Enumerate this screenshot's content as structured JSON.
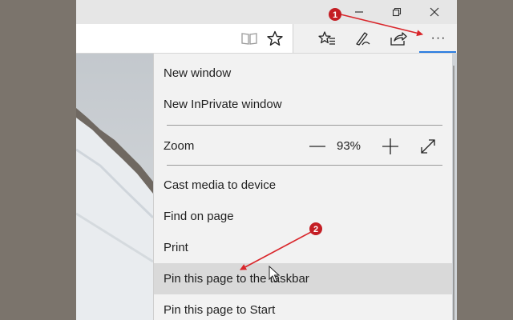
{
  "window_buttons": {
    "minimize_icon": "minimize-icon",
    "restore_icon": "restore-icon",
    "close_icon": "close-icon"
  },
  "toolbar": {
    "icons": [
      "reading-view-icon",
      "favorite-star-icon",
      "favorites-hub-icon",
      "web-note-pen-icon",
      "share-icon",
      "more-actions-icon"
    ],
    "more_label": "···"
  },
  "menu": {
    "items": [
      {
        "label": "New window"
      },
      {
        "label": "New InPrivate window"
      },
      {
        "label": "Cast media to device"
      },
      {
        "label": "Find on page"
      },
      {
        "label": "Print"
      },
      {
        "label": "Pin this page to the taskbar",
        "highlighted": true
      },
      {
        "label": "Pin this page to Start"
      }
    ],
    "zoom": {
      "label": "Zoom",
      "value": "93%"
    }
  },
  "annotations": {
    "callouts": [
      {
        "number": "1"
      },
      {
        "number": "2"
      }
    ],
    "color": "#d9262b"
  },
  "colors": {
    "accent": "#2b7de0",
    "desktop": "#7b746c",
    "menu_bg": "#f2f2f2",
    "highlight": "#d9d9d9"
  }
}
